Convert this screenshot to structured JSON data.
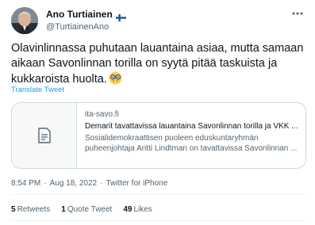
{
  "author": {
    "display_name": "Ano Turtiainen",
    "handle": "@TurtiainenAno",
    "flag_icon": "finland-flag-icon",
    "avatar_icon": "user-avatar-photo"
  },
  "menu": {
    "icon": "more-horizontal-icon"
  },
  "tweet": {
    "text": "Olavinlinnassa puhutaan lauantaina asiaa, mutta samaan aikaan Savonlinnan torilla on syytä pitää taskuista ja kukkaroista huolta.",
    "emoji": "nerd-face-emoji",
    "translate_label": "Translate Tweet"
  },
  "card": {
    "thumb_icon": "document-icon",
    "domain": "ita-savo.fi",
    "title": "Demarit tavattavissa lauantaina Savonlinnan torilla ja VKK ...",
    "description": "Sosialidemokraattisen puoleen eduskuntaryhmän puheenjohtaja Antti Lindtman on tavattavissa Savonlinnan ..."
  },
  "meta": {
    "time": "8:54 PM",
    "separator1": "·",
    "date": "Aug 18, 2022",
    "separator2": "·",
    "source": "Twitter for iPhone"
  },
  "stats": {
    "retweets_count": "5",
    "retweets_label": "Retweets",
    "quotes_count": "1",
    "quotes_label": "Quote Tweet",
    "likes_count": "49",
    "likes_label": "Likes"
  },
  "colors": {
    "link": "#1d9bf0",
    "secondary_text": "#536471",
    "border": "#cfd9de"
  }
}
